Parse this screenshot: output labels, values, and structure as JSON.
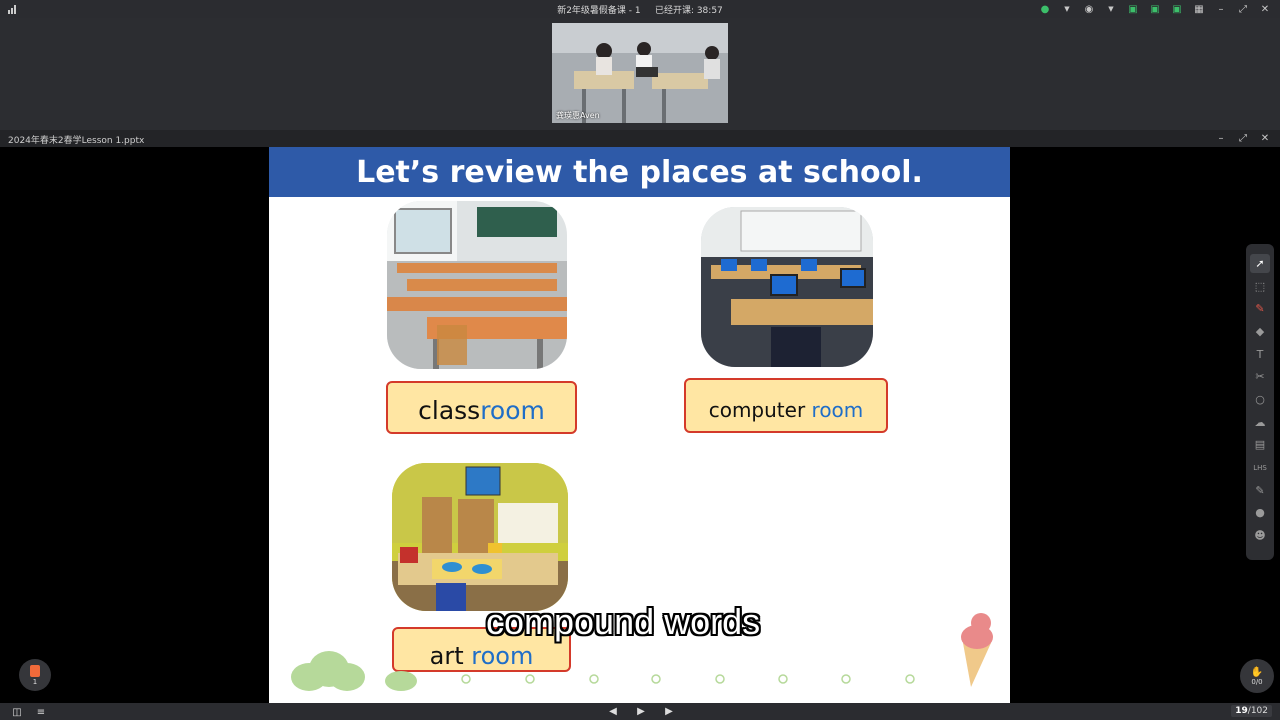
{
  "window": {
    "title": "新2年级暑假备课 - 1",
    "elapsed_label": "已经开课: 38:57"
  },
  "video": {
    "participant_name": "龚瑛惠Aven"
  },
  "document": {
    "filename": "2024年春末2春学Lesson 1.pptx"
  },
  "slide": {
    "title": "Let’s review the places at school.",
    "cards": [
      {
        "prefix": "class",
        "suffix": "room"
      },
      {
        "prefix": "computer ",
        "suffix": "room"
      },
      {
        "prefix": "art ",
        "suffix": "room"
      }
    ]
  },
  "caption": "compound words",
  "toolbar": {
    "tools": [
      "select-icon",
      "area-select-icon",
      "pen-icon",
      "eraser-icon",
      "text-icon",
      "scissors-icon",
      "shape-icon",
      "cloud-icon",
      "toolbox-icon",
      "ruler-icon",
      "note-icon",
      "chat-icon",
      "students-icon"
    ],
    "ruler_label": "LHS"
  },
  "page_badge": {
    "label": "1"
  },
  "record_badge": {
    "label": "0/0"
  },
  "pager": {
    "current": "19",
    "total": "/102"
  },
  "colors": {
    "title_bar": "#2e5aa8",
    "label_fill": "#ffe6a3",
    "label_border": "#d43a2a",
    "label_accent": "#1f6ec8"
  }
}
